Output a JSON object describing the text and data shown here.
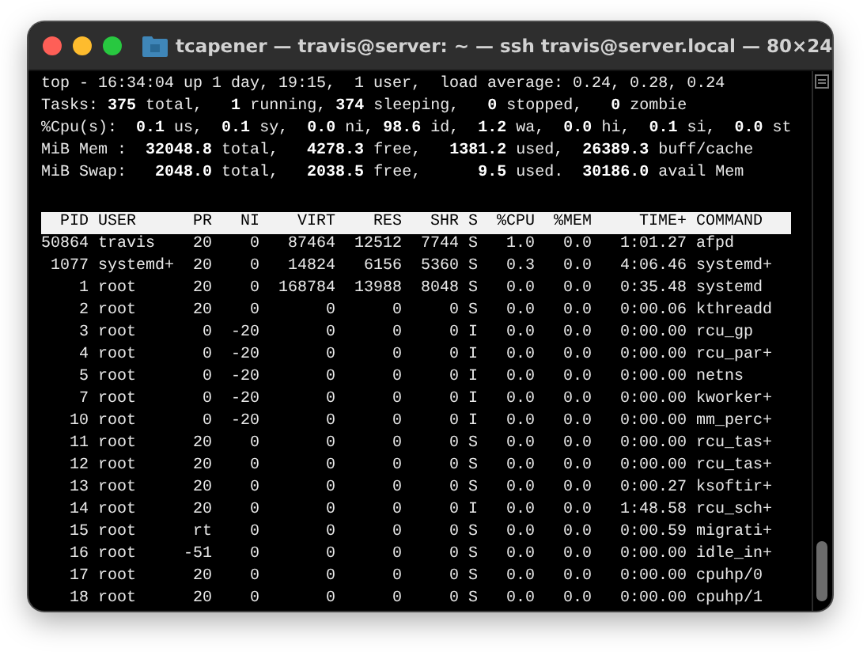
{
  "window": {
    "title": "tcapener — travis@server: ~ — ssh travis@server.local — 80×24"
  },
  "summary": [
    "top - 16:34:04 up 1 day, 19:15,  1 user,  load average: 0.24, 0.28, 0.24",
    "Tasks: **375** total,   **1** running, **374** sleeping,   **0** stopped,   **0** zombie",
    "%Cpu(s):  **0.1** us,  **0.1** sy,  **0.0** ni, **98.6** id,  **1.2** wa,  **0.0** hi,  **0.1** si,  **0.0** st",
    "MiB Mem :  **32048.8** total,   **4278.3** free,   **1381.2** used,  **26389.3** buff/cache",
    "MiB Swap:   **2048.0** total,   **2038.5** free,      **9.5** used.  **30186.0** avail Mem"
  ],
  "table": {
    "columns": [
      "PID",
      "USER",
      "PR",
      "NI",
      "VIRT",
      "RES",
      "SHR",
      "S",
      "%CPU",
      "%MEM",
      "TIME+",
      "COMMAND"
    ],
    "rows": [
      [
        "50864",
        "travis",
        "20",
        "0",
        "87464",
        "12512",
        "7744",
        "S",
        "1.0",
        "0.0",
        "1:01.27",
        "afpd"
      ],
      [
        "1077",
        "systemd+",
        "20",
        "0",
        "14824",
        "6156",
        "5360",
        "S",
        "0.3",
        "0.0",
        "4:06.46",
        "systemd+"
      ],
      [
        "1",
        "root",
        "20",
        "0",
        "168784",
        "13988",
        "8048",
        "S",
        "0.0",
        "0.0",
        "0:35.48",
        "systemd"
      ],
      [
        "2",
        "root",
        "20",
        "0",
        "0",
        "0",
        "0",
        "S",
        "0.0",
        "0.0",
        "0:00.06",
        "kthreadd"
      ],
      [
        "3",
        "root",
        "0",
        "-20",
        "0",
        "0",
        "0",
        "I",
        "0.0",
        "0.0",
        "0:00.00",
        "rcu_gp"
      ],
      [
        "4",
        "root",
        "0",
        "-20",
        "0",
        "0",
        "0",
        "I",
        "0.0",
        "0.0",
        "0:00.00",
        "rcu_par+"
      ],
      [
        "5",
        "root",
        "0",
        "-20",
        "0",
        "0",
        "0",
        "I",
        "0.0",
        "0.0",
        "0:00.00",
        "netns"
      ],
      [
        "7",
        "root",
        "0",
        "-20",
        "0",
        "0",
        "0",
        "I",
        "0.0",
        "0.0",
        "0:00.00",
        "kworker+"
      ],
      [
        "10",
        "root",
        "0",
        "-20",
        "0",
        "0",
        "0",
        "I",
        "0.0",
        "0.0",
        "0:00.00",
        "mm_perc+"
      ],
      [
        "11",
        "root",
        "20",
        "0",
        "0",
        "0",
        "0",
        "S",
        "0.0",
        "0.0",
        "0:00.00",
        "rcu_tas+"
      ],
      [
        "12",
        "root",
        "20",
        "0",
        "0",
        "0",
        "0",
        "S",
        "0.0",
        "0.0",
        "0:00.00",
        "rcu_tas+"
      ],
      [
        "13",
        "root",
        "20",
        "0",
        "0",
        "0",
        "0",
        "S",
        "0.0",
        "0.0",
        "0:00.27",
        "ksoftir+"
      ],
      [
        "14",
        "root",
        "20",
        "0",
        "0",
        "0",
        "0",
        "I",
        "0.0",
        "0.0",
        "1:48.58",
        "rcu_sch+"
      ],
      [
        "15",
        "root",
        "rt",
        "0",
        "0",
        "0",
        "0",
        "S",
        "0.0",
        "0.0",
        "0:00.59",
        "migrati+"
      ],
      [
        "16",
        "root",
        "-51",
        "0",
        "0",
        "0",
        "0",
        "S",
        "0.0",
        "0.0",
        "0:00.00",
        "idle_in+"
      ],
      [
        "17",
        "root",
        "20",
        "0",
        "0",
        "0",
        "0",
        "S",
        "0.0",
        "0.0",
        "0:00.00",
        "cpuhp/0"
      ],
      [
        "18",
        "root",
        "20",
        "0",
        "0",
        "0",
        "0",
        "S",
        "0.0",
        "0.0",
        "0:00.00",
        "cpuhp/1"
      ]
    ]
  }
}
